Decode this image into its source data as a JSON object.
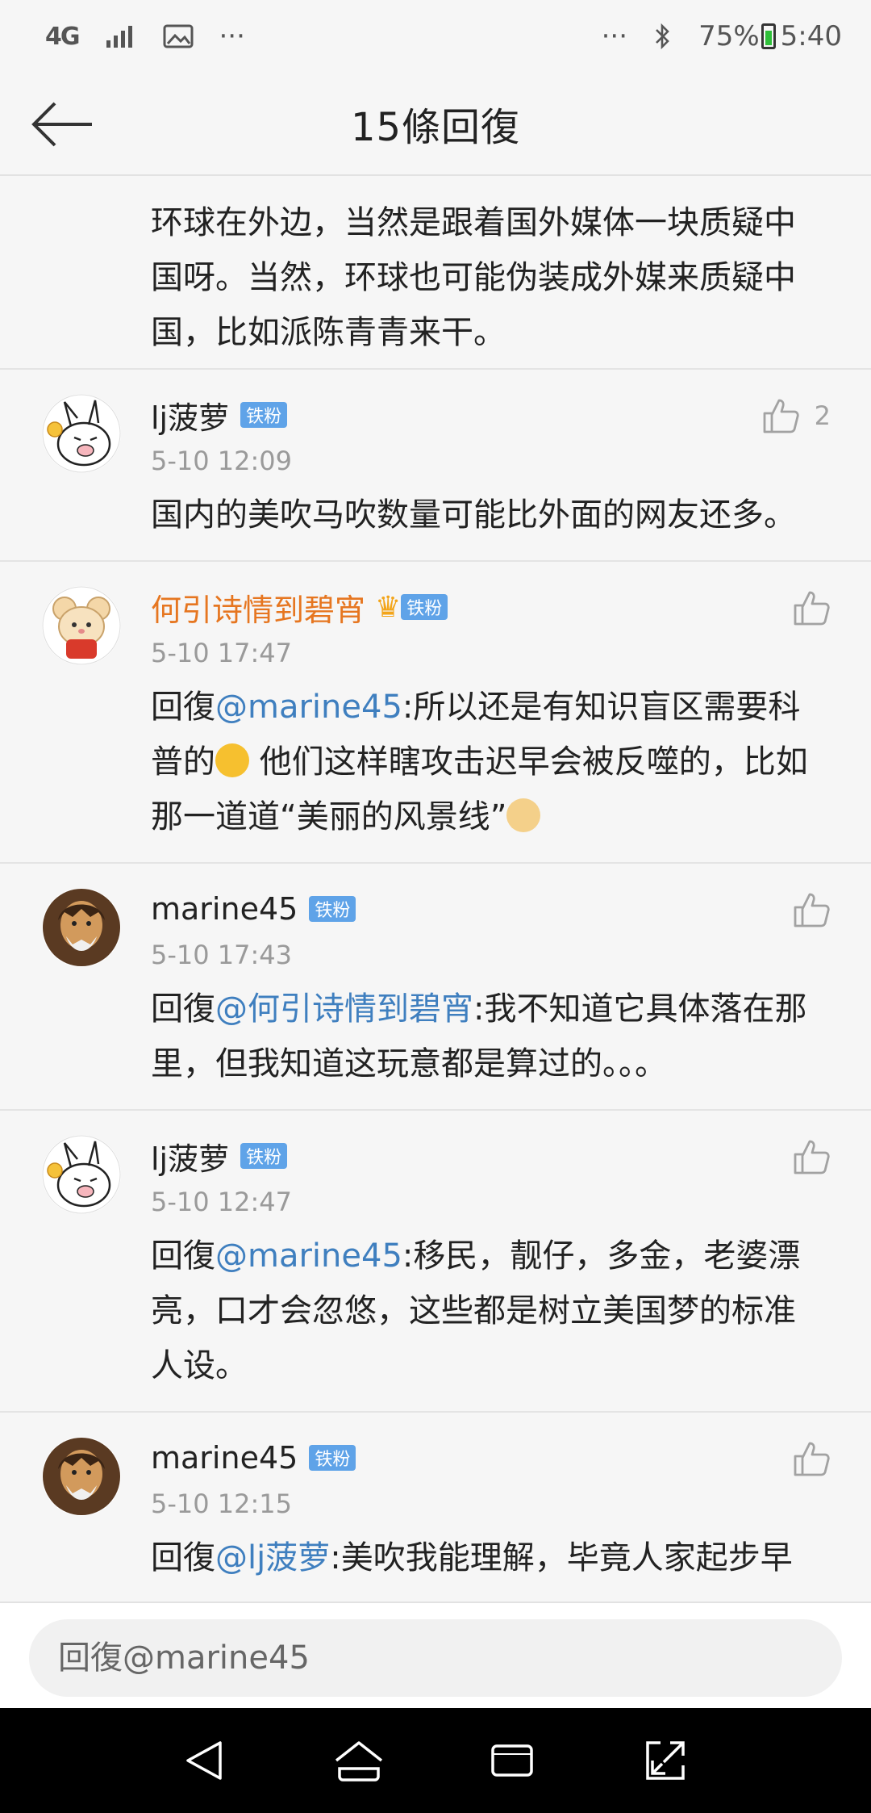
{
  "status_bar": {
    "network": "4G",
    "more_left": "···",
    "more_right": "···",
    "battery_percent": "75%",
    "time": "5:40"
  },
  "header": {
    "title": "15條回復"
  },
  "lead_comment": {
    "text": "环球在外边，当然是跟着国外媒体一块质疑中国呀。当然，环球也可能伪装成外媒来质疑中国，比如派陈青青来干。"
  },
  "comments": [
    {
      "username": "lj菠萝",
      "badge": "铁粉",
      "time": "5-10 12:09",
      "likes": "2",
      "text": "国内的美吹马吹数量可能比外面的网友还多。"
    },
    {
      "username": "何引诗情到碧宵",
      "badge": "铁粉",
      "time": "5-10 17:47",
      "reply_prefix": "回復",
      "mention": "@marine45",
      "text_a": ":所以还是有知识盲区需要科普的",
      "text_b": " 他们这样瞎攻击迟早会被反噬的，比如那一道道“美丽的风景线”"
    },
    {
      "username": "marine45",
      "badge": "铁粉",
      "time": "5-10 17:43",
      "reply_prefix": "回復",
      "mention": "@何引诗情到碧宵",
      "text": ":我不知道它具体落在那里，但我知道这玩意都是算过的。。。"
    },
    {
      "username": "lj菠萝",
      "badge": "铁粉",
      "time": "5-10 12:47",
      "reply_prefix": "回復",
      "mention": "@marine45",
      "text": ":移民，靓仔，多金，老婆漂亮，口才会忽悠，这些都是树立美国梦的标准人设。"
    },
    {
      "username": "marine45",
      "badge": "铁粉",
      "time": "5-10 12:15",
      "reply_prefix": "回復",
      "mention": "@lj菠萝",
      "text": ":美吹我能理解，毕竟人家起步早"
    }
  ],
  "reply_bar": {
    "placeholder": "回復@marine45"
  },
  "colors": {
    "accent_link": "#3f7fbf",
    "vip_name": "#e67620",
    "badge_bg": "#5fa3e8"
  }
}
